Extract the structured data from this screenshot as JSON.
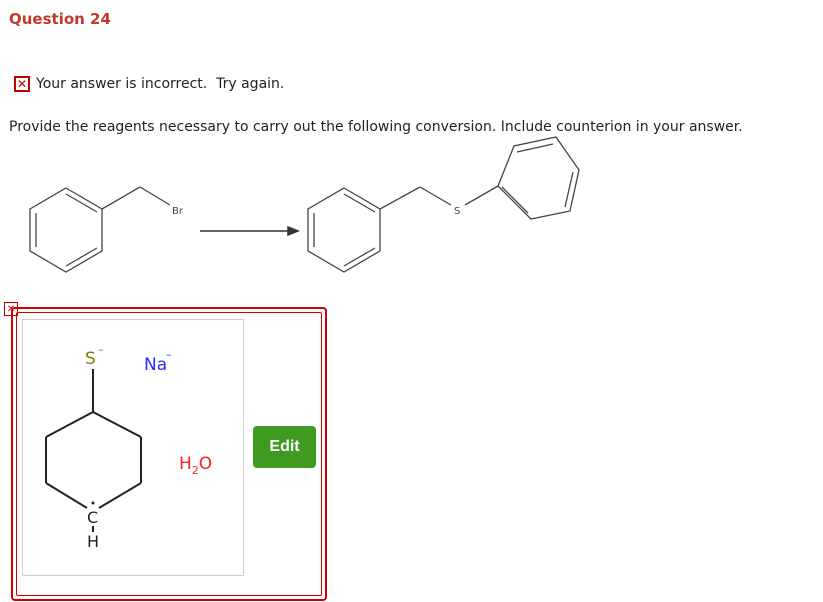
{
  "question": {
    "title": "Question 24"
  },
  "feedback": {
    "icon": "x-mark-icon",
    "text": "Your answer is incorrect.  Try again."
  },
  "prompt": {
    "text": "Provide the reagents necessary to carry out the following conversion. Include counterion in your answer."
  },
  "reaction": {
    "reactant_label": "Br",
    "product_label": "S"
  },
  "answer": {
    "thiolate_label": "S",
    "thiolate_charge": "–",
    "sodium_label": "Na",
    "sodium_charge": "–",
    "carbon_label": "C",
    "hydrogen_label": "H",
    "water_h": "H",
    "water_sub": "2",
    "water_o": "O"
  },
  "edit_button": {
    "label": "Edit"
  },
  "colors": {
    "title": "#c0392b",
    "error": "#c00000",
    "edit": "#3f9b1f",
    "sulfur": "#808000",
    "sodium": "#2a2aff",
    "water": "#ff2020"
  }
}
